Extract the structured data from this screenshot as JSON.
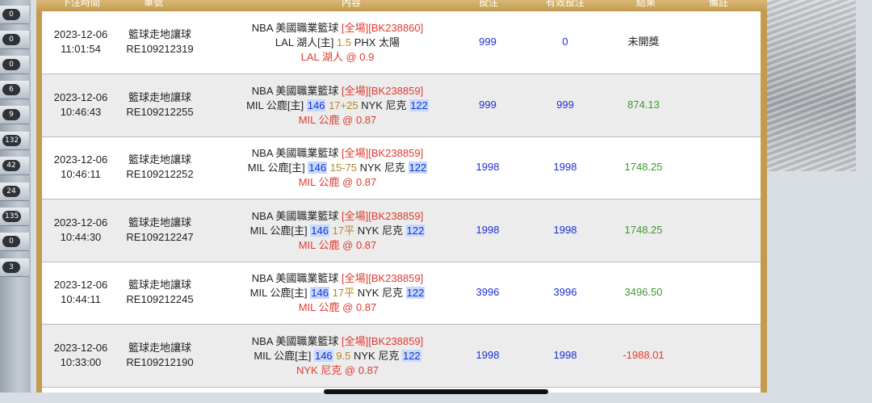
{
  "sidebar": {
    "counts": [
      "0",
      "0",
      "0",
      "6",
      "9",
      "132",
      "42",
      "24",
      "135",
      "0",
      "3"
    ]
  },
  "table": {
    "headers": [
      "下注時間",
      "單號",
      "內容",
      "投注",
      "有效投注",
      "結果",
      "備註"
    ],
    "rows": [
      {
        "date": "2023-12-06",
        "time": "11:01:54",
        "type": "籃球走地讓球",
        "order": "RE109212319",
        "league": "NBA 美國職業籃球",
        "scope": "[全場]",
        "code": "[BK238860]",
        "home": "LAL 湖人[主]",
        "score_home": "",
        "line": "1.5",
        "away": "PHX 太陽",
        "score_away": "",
        "pick": "LAL 湖人",
        "odds": "@ 0.9",
        "stake": "999",
        "valid": "0",
        "result": "未開獎",
        "result_color": "#222"
      },
      {
        "date": "2023-12-06",
        "time": "10:46:43",
        "type": "籃球走地讓球",
        "order": "RE109212255",
        "league": "NBA 美國職業籃球",
        "scope": "[全場]",
        "code": "[BK238859]",
        "home": "MIL 公鹿[主]",
        "score_home": "146",
        "line": "17+25",
        "away": "NYK 尼克",
        "score_away": "122",
        "pick": "MIL 公鹿",
        "odds": "@ 0.87",
        "stake": "999",
        "valid": "999",
        "result": "874.13",
        "result_color": "#3c9a2c"
      },
      {
        "date": "2023-12-06",
        "time": "10:46:11",
        "type": "籃球走地讓球",
        "order": "RE109212252",
        "league": "NBA 美國職業籃球",
        "scope": "[全場]",
        "code": "[BK238859]",
        "home": "MIL 公鹿[主]",
        "score_home": "146",
        "line": "15-75",
        "away": "NYK 尼克",
        "score_away": "122",
        "pick": "MIL 公鹿",
        "odds": "@ 0.87",
        "stake": "1998",
        "valid": "1998",
        "result": "1748.25",
        "result_color": "#3c9a2c"
      },
      {
        "date": "2023-12-06",
        "time": "10:44:30",
        "type": "籃球走地讓球",
        "order": "RE109212247",
        "league": "NBA 美國職業籃球",
        "scope": "[全場]",
        "code": "[BK238859]",
        "home": "MIL 公鹿[主]",
        "score_home": "146",
        "line": "17平",
        "away": "NYK 尼克",
        "score_away": "122",
        "pick": "MIL 公鹿",
        "odds": "@ 0.87",
        "stake": "1998",
        "valid": "1998",
        "result": "1748.25",
        "result_color": "#3c9a2c"
      },
      {
        "date": "2023-12-06",
        "time": "10:44:11",
        "type": "籃球走地讓球",
        "order": "RE109212245",
        "league": "NBA 美國職業籃球",
        "scope": "[全場]",
        "code": "[BK238859]",
        "home": "MIL 公鹿[主]",
        "score_home": "146",
        "line": "17平",
        "away": "NYK 尼克",
        "score_away": "122",
        "pick": "MIL 公鹿",
        "odds": "@ 0.87",
        "stake": "3996",
        "valid": "3996",
        "result": "3496.50",
        "result_color": "#3c9a2c"
      },
      {
        "date": "2023-12-06",
        "time": "10:33:00",
        "type": "籃球走地讓球",
        "order": "RE109212190",
        "league": "NBA 美國職業籃球",
        "scope": "[全場]",
        "code": "[BK238859]",
        "home": "MIL 公鹿[主]",
        "score_home": "146",
        "line": "9.5",
        "away": "NYK 尼克",
        "score_away": "122",
        "pick": "NYK 尼克",
        "odds": "@ 0.87",
        "stake": "1998",
        "valid": "1998",
        "result": "-1988.01",
        "result_color": "#e23a2e"
      }
    ]
  }
}
